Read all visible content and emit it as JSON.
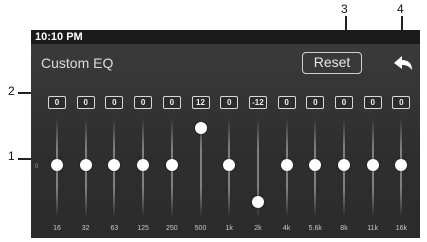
{
  "status_bar": {
    "time": "10:10 PM"
  },
  "header": {
    "title": "Custom EQ",
    "reset_label": "Reset",
    "back_icon": "back-arrow-icon"
  },
  "eq": {
    "zero_label": "0",
    "range_db": [
      -12,
      12
    ],
    "bands": [
      {
        "freq": "16",
        "gain": "0"
      },
      {
        "freq": "32",
        "gain": "0"
      },
      {
        "freq": "63",
        "gain": "0"
      },
      {
        "freq": "125",
        "gain": "0"
      },
      {
        "freq": "250",
        "gain": "0"
      },
      {
        "freq": "500",
        "gain": "12"
      },
      {
        "freq": "1k",
        "gain": "0"
      },
      {
        "freq": "2k",
        "gain": "-12"
      },
      {
        "freq": "4k",
        "gain": "0"
      },
      {
        "freq": "5.6k",
        "gain": "0"
      },
      {
        "freq": "8k",
        "gain": "0"
      },
      {
        "freq": "11k",
        "gain": "0"
      },
      {
        "freq": "16k",
        "gain": "0"
      }
    ]
  },
  "callouts": [
    "1",
    "2",
    "3",
    "4"
  ],
  "colors": {
    "screen_bg": "#333333",
    "status_bar_bg": "#1b1b1b",
    "knob": "#ffffff",
    "text": "#dcdcdc"
  }
}
